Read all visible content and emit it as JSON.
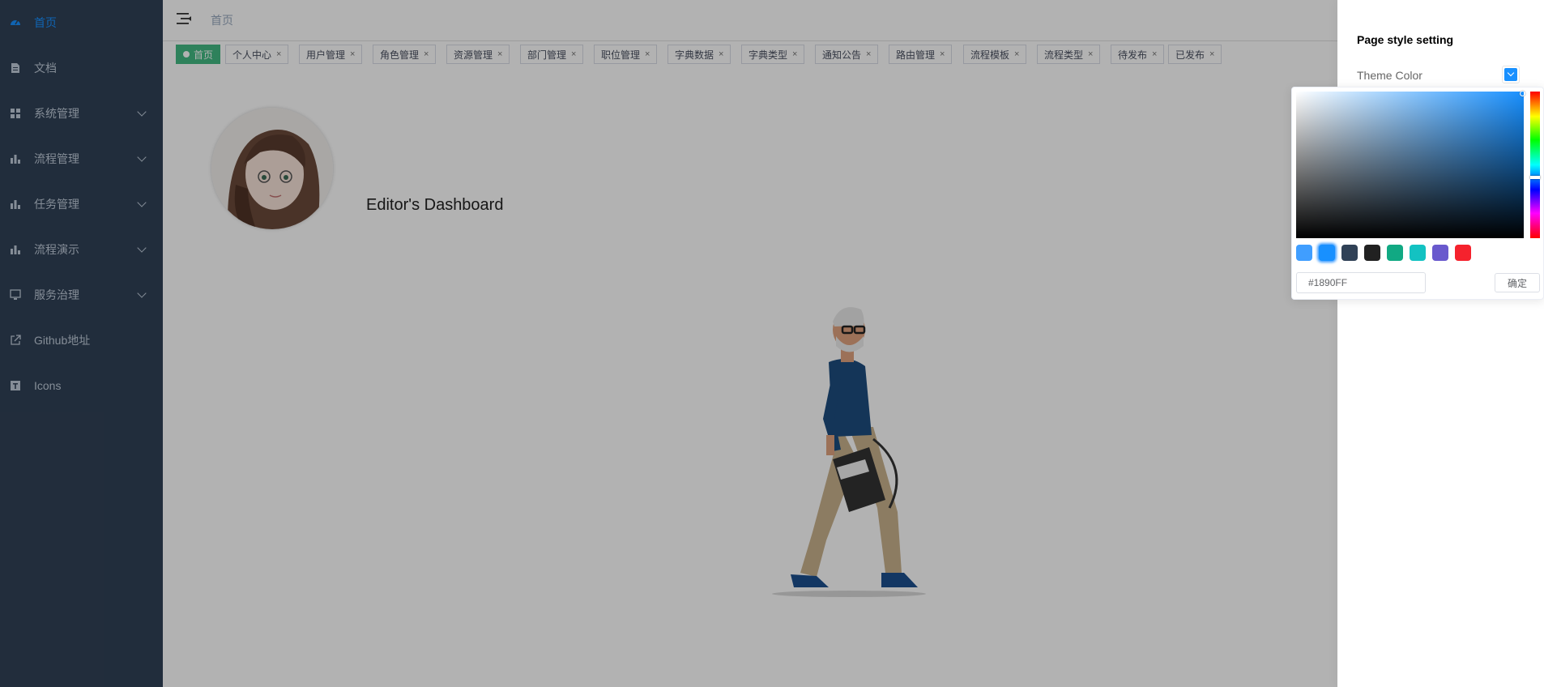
{
  "sidebar": {
    "items": [
      {
        "label": "首页",
        "icon": "dashboard-icon",
        "active": true,
        "submenu": false
      },
      {
        "label": "文档",
        "icon": "document-icon",
        "active": false,
        "submenu": false
      },
      {
        "label": "系统管理",
        "icon": "system-grid-icon",
        "active": false,
        "submenu": true
      },
      {
        "label": "流程管理",
        "icon": "chart-bar-icon",
        "active": false,
        "submenu": true
      },
      {
        "label": "任务管理",
        "icon": "chart-bar-icon",
        "active": false,
        "submenu": true
      },
      {
        "label": "流程演示",
        "icon": "chart-bar-icon",
        "active": false,
        "submenu": true
      },
      {
        "label": "服务治理",
        "icon": "monitor-icon",
        "active": false,
        "submenu": true
      },
      {
        "label": "Github地址",
        "icon": "external-link-icon",
        "active": false,
        "submenu": false
      },
      {
        "label": "Icons",
        "icon": "icons-icon",
        "active": false,
        "submenu": false
      }
    ],
    "background": "#304156",
    "text_color": "#bfcbd9",
    "active_color": "#1890ff"
  },
  "navbar": {
    "breadcrumb": "首页"
  },
  "tags": [
    {
      "label": "首页",
      "active": true
    },
    {
      "label": "个人中心"
    },
    {
      "label": "用户管理"
    },
    {
      "label": "角色管理"
    },
    {
      "label": "资源管理"
    },
    {
      "label": "部门管理"
    },
    {
      "label": "职位管理"
    },
    {
      "label": "字典数据"
    },
    {
      "label": "字典类型"
    },
    {
      "label": "通知公告"
    },
    {
      "label": "路由管理"
    },
    {
      "label": "流程模板"
    },
    {
      "label": "流程类型"
    },
    {
      "label": "待发布"
    },
    {
      "label": "已发布"
    }
  ],
  "tag_close_symbol": "×",
  "tag_active_color": "#42b983",
  "dashboard": {
    "title": "Editor's Dashboard"
  },
  "settings": {
    "title": "Page style setting",
    "theme_label": "Theme Color",
    "theme_value": "#1890ff"
  },
  "color_picker": {
    "hex_value": "#1890FF",
    "confirm_label": "确定",
    "presets": [
      "#409EFF",
      "#1890ff",
      "#304156",
      "#212121",
      "#11a983",
      "#13c2c2",
      "#6959CD",
      "#f5222d"
    ],
    "selected_preset": "#1890ff"
  }
}
